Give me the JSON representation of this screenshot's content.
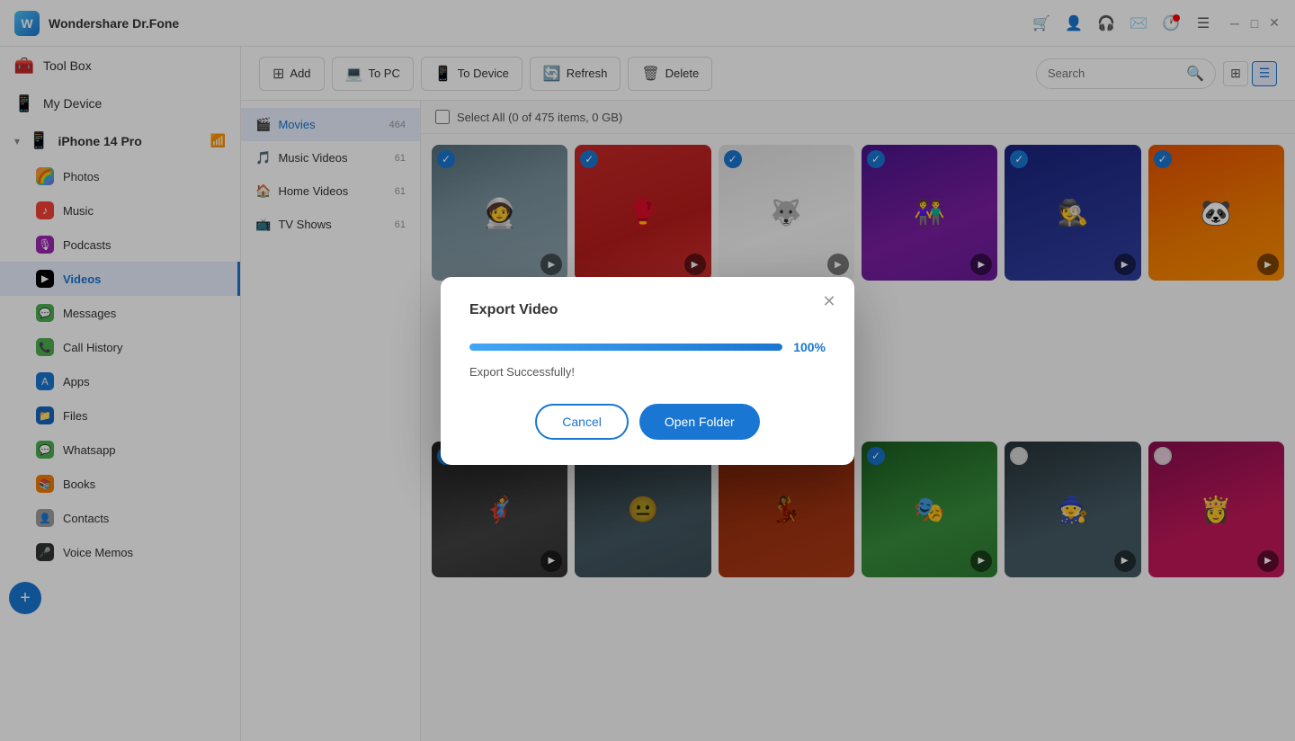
{
  "app": {
    "title": "Wondershare Dr.Fone",
    "logo_text": "W"
  },
  "titlebar": {
    "icons": [
      "cart",
      "user",
      "headset",
      "mail",
      "clock",
      "list"
    ],
    "window_controls": [
      "minimize",
      "maximize",
      "close"
    ]
  },
  "sidebar": {
    "toolbox_label": "Tool Box",
    "my_device_label": "My Device",
    "device_name": "iPhone 14 Pro",
    "items": [
      {
        "id": "photos",
        "label": "Photos",
        "icon": "📷"
      },
      {
        "id": "music",
        "label": "Music",
        "icon": "🎵"
      },
      {
        "id": "podcasts",
        "label": "Podcasts",
        "icon": "🎙"
      },
      {
        "id": "videos",
        "label": "Videos",
        "icon": "📺",
        "active": true
      },
      {
        "id": "messages",
        "label": "Messages",
        "icon": "💬"
      },
      {
        "id": "callhistory",
        "label": "Call History",
        "icon": "📞"
      },
      {
        "id": "apps",
        "label": "Apps",
        "icon": "🅰"
      },
      {
        "id": "files",
        "label": "Files",
        "icon": "📁"
      },
      {
        "id": "whatsapp",
        "label": "Whatsapp",
        "icon": "💬"
      },
      {
        "id": "books",
        "label": "Books",
        "icon": "📚"
      },
      {
        "id": "contacts",
        "label": "Contacts",
        "icon": "👤"
      },
      {
        "id": "voicememos",
        "label": "Voice Memos",
        "icon": "🎤"
      }
    ]
  },
  "subnav": {
    "items": [
      {
        "id": "movies",
        "label": "Movies",
        "count": "464",
        "active": true
      },
      {
        "id": "music-videos",
        "label": "Music Videos",
        "count": "61"
      },
      {
        "id": "home-videos",
        "label": "Home Videos",
        "count": "61"
      },
      {
        "id": "tv-shows",
        "label": "TV Shows",
        "count": "61"
      }
    ]
  },
  "toolbar": {
    "add_label": "Add",
    "to_pc_label": "To PC",
    "to_device_label": "To Device",
    "refresh_label": "Refresh",
    "delete_label": "Delete",
    "search_placeholder": "Search"
  },
  "select_all": {
    "label": "Select All (0 of 475 items, 0 GB)"
  },
  "videos": {
    "items": [
      {
        "id": "v1",
        "checked": true,
        "class": "vt-1"
      },
      {
        "id": "v2",
        "checked": true,
        "class": "vt-2"
      },
      {
        "id": "v3",
        "checked": true,
        "class": "vt-3"
      },
      {
        "id": "v4",
        "checked": true,
        "class": "vt-4"
      },
      {
        "id": "v5",
        "checked": true,
        "class": "vt-5"
      },
      {
        "id": "v6",
        "checked": true,
        "class": "vt-6"
      },
      {
        "id": "v7",
        "checked": true,
        "class": "vt-7"
      },
      {
        "id": "v8",
        "checked": false,
        "class": "vt-8"
      },
      {
        "id": "v9",
        "checked": false,
        "class": "vt-9"
      },
      {
        "id": "v10",
        "checked": true,
        "class": "vt-10"
      },
      {
        "id": "v11",
        "checked": false,
        "class": "vt-11"
      },
      {
        "id": "v12",
        "checked": false,
        "class": "vt-12"
      }
    ]
  },
  "modal": {
    "title": "Export Video",
    "progress_pct": 100,
    "progress_pct_label": "100%",
    "status": "Export Successfully!",
    "cancel_label": "Cancel",
    "open_folder_label": "Open Folder"
  }
}
